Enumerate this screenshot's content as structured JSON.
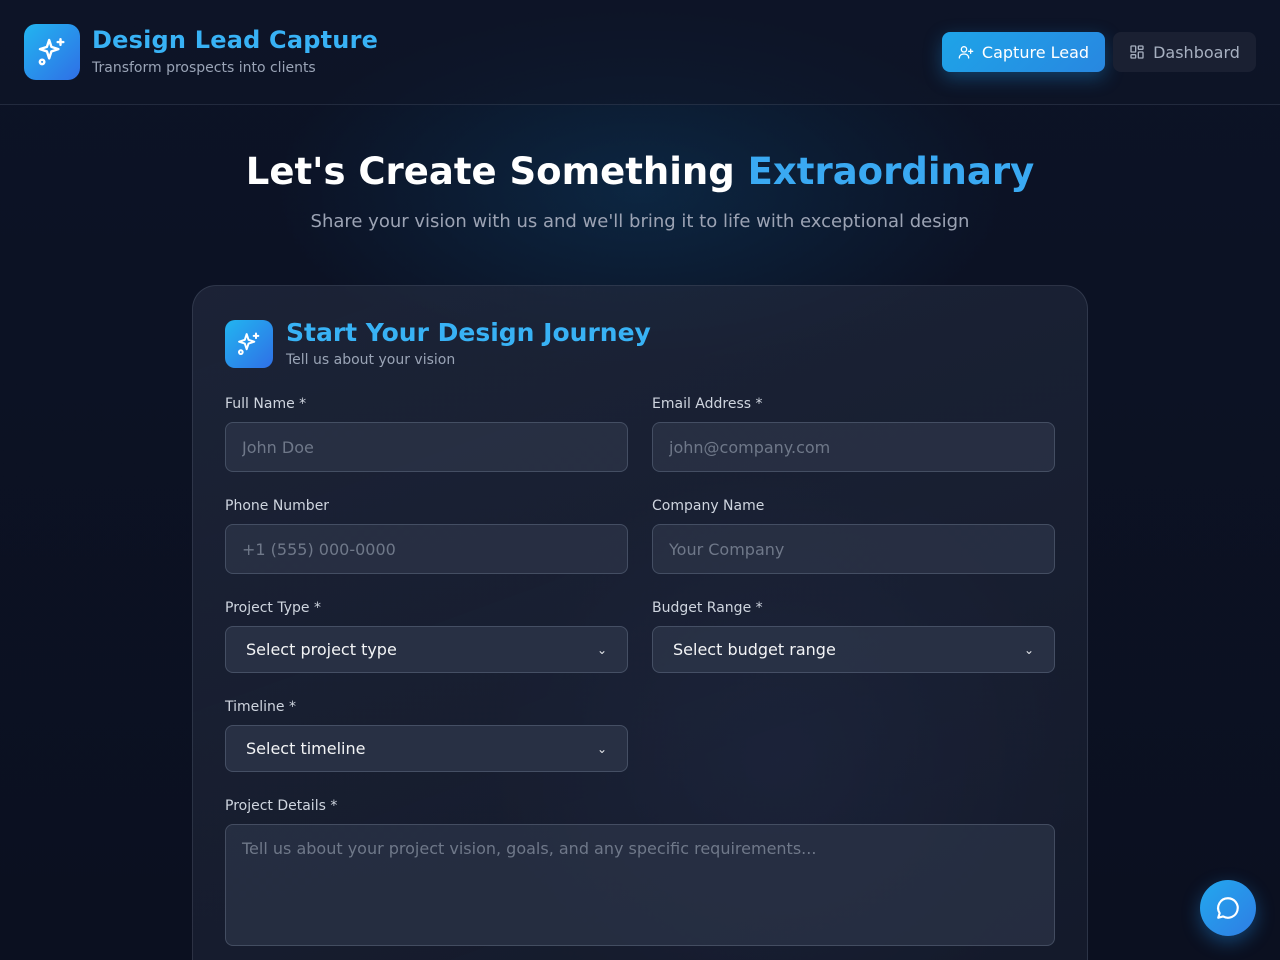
{
  "header": {
    "brand_title": "Design Lead Capture",
    "brand_subtitle": "Transform prospects into clients",
    "logo_icon": "sparkles-icon",
    "nav": {
      "capture_label": "Capture Lead",
      "capture_icon": "user-plus-icon",
      "dashboard_label": "Dashboard",
      "dashboard_icon": "grid-icon"
    }
  },
  "hero": {
    "title_main": "Let's Create Something ",
    "title_accent": "Extraordinary",
    "subtitle": "Share your vision with us and we'll bring it to life with exceptional design"
  },
  "form": {
    "title": "Start Your Design Journey",
    "subtitle": "Tell us about your vision",
    "icon": "sparkles-icon",
    "full_name": {
      "label": "Full Name *",
      "placeholder": "John Doe",
      "value": ""
    },
    "email": {
      "label": "Email Address *",
      "placeholder": "john@company.com",
      "value": ""
    },
    "phone": {
      "label": "Phone Number",
      "placeholder": "+1 (555) 000-0000",
      "value": ""
    },
    "company": {
      "label": "Company Name",
      "placeholder": "Your Company",
      "value": ""
    },
    "project_type": {
      "label": "Project Type *",
      "selected": "Select project type"
    },
    "budget": {
      "label": "Budget Range *",
      "selected": "Select budget range"
    },
    "timeline": {
      "label": "Timeline *",
      "selected": "Select timeline"
    },
    "details": {
      "label": "Project Details *",
      "placeholder": "Tell us about your project vision, goals, and any specific requirements...",
      "value": ""
    }
  },
  "chat": {
    "icon": "chat-bubble-icon"
  },
  "colors": {
    "accent": "#38b2f5",
    "button_gradient_start": "#1ea4e8",
    "button_gradient_end": "#2887e0",
    "background": "#0b1020"
  }
}
